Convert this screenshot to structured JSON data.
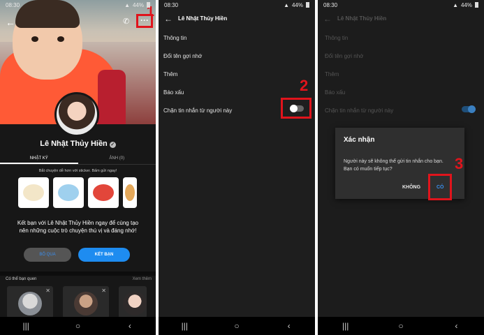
{
  "status": {
    "time": "08:30",
    "battery": "44%"
  },
  "steps": [
    "1",
    "2",
    "3"
  ],
  "panel1": {
    "profile_name": "Lê Nhật Thủy Hiền",
    "verified_glyph": "✓",
    "tabs": [
      "NHẬT KÝ",
      "ẢNH (0)"
    ],
    "sticker_prompt": "Bắt chuyện dễ hơn với sticker. Bấm gửi ngay!",
    "friend_text": "Kết bạn với Lê Nhật Thủy Hiền ngay để cùng tạo nên những cuộc trò chuyện thú vị và đáng nhớ!",
    "ignore_label": "BỎ QUA",
    "add_friend_label": "KẾT BẠN",
    "suggest_title": "Có thể bạn quen",
    "suggest_more": "Xem thêm",
    "more_glyph": "···"
  },
  "panel2": {
    "title": "Lê Nhật Thủy Hiền",
    "menu": [
      "Thông tin",
      "Đổi tên gợi nhớ",
      "Thêm",
      "Báo xấu",
      "Chặn tin nhắn từ người này"
    ],
    "block_toggle_on": false
  },
  "panel3": {
    "title": "Lê Nhật Thủy Hiền",
    "menu": [
      "Thông tin",
      "Đổi tên gợi nhớ",
      "Thêm",
      "Báo xấu",
      "Chặn tin nhắn từ người này"
    ],
    "dialog": {
      "title": "Xác nhận",
      "message": "Người này sẽ không thể gửi tin nhắn cho bạn. Bạn có muốn tiếp tục?",
      "no_label": "KHÔNG",
      "yes_label": "CÓ"
    }
  },
  "navbar": {
    "recent": "|||",
    "home": "○",
    "back": "‹"
  },
  "colors": {
    "highlight": "#e0141c",
    "accent": "#1e8cf0"
  }
}
